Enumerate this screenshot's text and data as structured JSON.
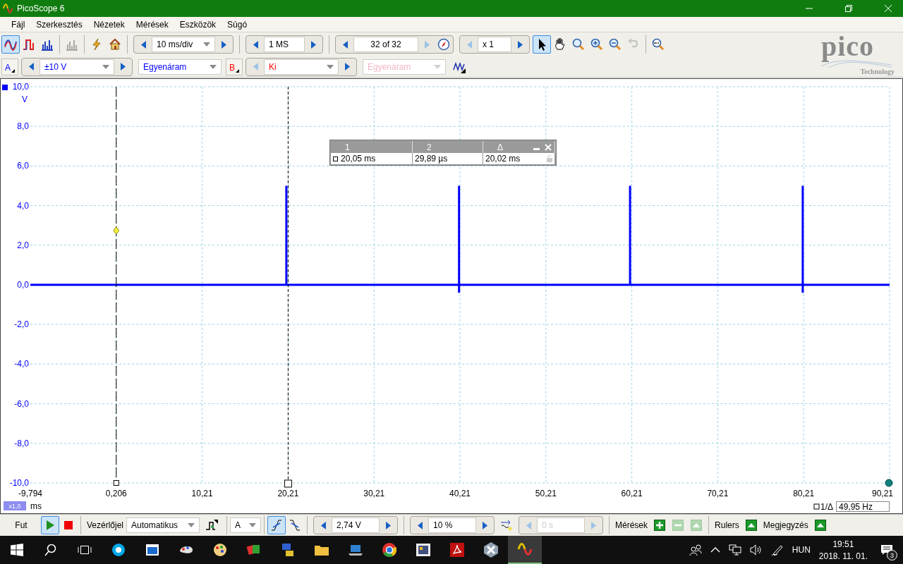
{
  "window": {
    "title": "PicoScope 6"
  },
  "menu": [
    "Fájl",
    "Szerkesztés",
    "Nézetek",
    "Mérések",
    "Eszközök",
    "Súgó"
  ],
  "view_modes": [
    {
      "kind": "scope",
      "selected": true,
      "disabled": false
    },
    {
      "kind": "persistence",
      "selected": false,
      "disabled": false
    },
    {
      "kind": "spectrum",
      "selected": false,
      "disabled": false
    },
    {
      "kind": "spectrum",
      "selected": false,
      "disabled": true
    }
  ],
  "logo": {
    "name": "pico",
    "tagline": "Technology"
  },
  "timebase": "10 ms/div",
  "samples": "1 MS",
  "buffer": "32 of 32",
  "zoom_factor": "x 1",
  "tools": [
    {
      "kind": "pointer",
      "selected": true,
      "disabled": false
    },
    {
      "kind": "hand",
      "selected": false,
      "disabled": false
    },
    {
      "kind": "zoom-fit",
      "selected": false,
      "disabled": false
    },
    {
      "kind": "zoom-in",
      "selected": false,
      "disabled": false
    },
    {
      "kind": "zoom-out",
      "selected": false,
      "disabled": false
    },
    {
      "kind": "undo",
      "selected": false,
      "disabled": true
    },
    {
      "kind": "zoom-100",
      "selected": false,
      "disabled": false
    }
  ],
  "channels": [
    {
      "label": "A",
      "range": "±10 V",
      "coupling": "Egyenáram",
      "color": "#0000ff",
      "enabled": true
    },
    {
      "label": "B",
      "range": "Ki",
      "coupling": "Egyenáram",
      "color": "#ff0000",
      "enabled": false
    }
  ],
  "scope": {
    "chart_data": {
      "type": "line",
      "xlabel": "ms",
      "ylabel": "V",
      "x": [
        -9.794,
        20.0,
        20.0,
        20.0,
        40.1,
        40.1,
        40.1,
        40.1,
        60.0,
        60.0,
        60.0,
        80.1,
        80.1,
        80.1,
        80.1,
        90.21
      ],
      "series": [
        {
          "color": "#0000ff",
          "values": [
            0,
            0,
            5,
            0,
            0,
            5,
            -0.4,
            0,
            0,
            5,
            0,
            0,
            5,
            -0.4,
            0,
            0
          ]
        }
      ],
      "xlim": [
        -9.794,
        90.21
      ],
      "ylim": [
        -10,
        10
      ],
      "xticks": [
        {
          "value": -9.794,
          "label": "-9,794"
        },
        {
          "value": 0.206,
          "label": "0,206"
        },
        {
          "value": 10.21,
          "label": "10,21"
        },
        {
          "value": 20.21,
          "label": "20,21"
        },
        {
          "value": 30.21,
          "label": "30,21"
        },
        {
          "value": 40.21,
          "label": "40,21"
        },
        {
          "value": 50.21,
          "label": "50,21"
        },
        {
          "value": 60.21,
          "label": "60,21"
        },
        {
          "value": 70.21,
          "label": "70,21"
        },
        {
          "value": 80.21,
          "label": "80,21"
        },
        {
          "value": 90.21,
          "label": "90,21"
        }
      ],
      "yticks": [
        {
          "value": 10,
          "label": "10,0"
        },
        {
          "value": 8,
          "label": "8,0"
        },
        {
          "value": 6,
          "label": "6,0"
        },
        {
          "value": 4,
          "label": "4,0"
        },
        {
          "value": 2,
          "label": "2,0"
        },
        {
          "value": 0,
          "label": "0,0"
        },
        {
          "value": -2,
          "label": "-2,0"
        },
        {
          "value": -4,
          "label": "-4,0"
        },
        {
          "value": -6,
          "label": "-6,0"
        },
        {
          "value": -8,
          "label": "-8,0"
        },
        {
          "value": -10,
          "label": "-10,0"
        }
      ],
      "grid": true
    },
    "scale_badge": "x1,0",
    "ruler_table": {
      "headers": [
        "1",
        "2",
        "Δ"
      ],
      "values": [
        "20,05 ms",
        "29,89 µs",
        "20,02 ms"
      ]
    },
    "frequency": {
      "label": "1/Δ",
      "value": "49,95 Hz"
    }
  },
  "bottom_bar": {
    "run_label": "Fut",
    "running": true,
    "trigger_label": "Vezérlőjel",
    "trigger_mode": "Automatikus",
    "trigger_channel": "A",
    "edges": [
      {
        "kind": "rising",
        "selected": true
      },
      {
        "kind": "falling",
        "selected": false
      }
    ],
    "threshold": "2,74 V",
    "pretrigger": "10 %",
    "delay": "0 s",
    "delay_disabled": true,
    "measurements_label": "Mérések",
    "measure_buttons": [
      {
        "kind": "add",
        "disabled": false
      },
      {
        "kind": "remove",
        "disabled": true
      },
      {
        "kind": "up",
        "disabled": true
      }
    ],
    "rulers_label": "Rulers",
    "notes_label": "Megjegyzés"
  },
  "taskbar": {
    "apps": [
      {
        "kind": "chat",
        "active": false
      },
      {
        "kind": "window",
        "active": false
      },
      {
        "kind": "paint",
        "active": false
      },
      {
        "kind": "palette",
        "active": false
      },
      {
        "kind": "cards",
        "active": false
      },
      {
        "kind": "network",
        "active": false
      },
      {
        "kind": "folder",
        "active": false
      },
      {
        "kind": "laptop",
        "active": false
      },
      {
        "kind": "browser",
        "active": false
      },
      {
        "kind": "film",
        "active": false
      },
      {
        "kind": "document",
        "active": false
      },
      {
        "kind": "hexagon",
        "active": false
      },
      {
        "kind": "wave",
        "active": true
      }
    ],
    "language": "HUN",
    "time": "19:51",
    "date": "2018. 11. 01.",
    "notifications": "3"
  }
}
